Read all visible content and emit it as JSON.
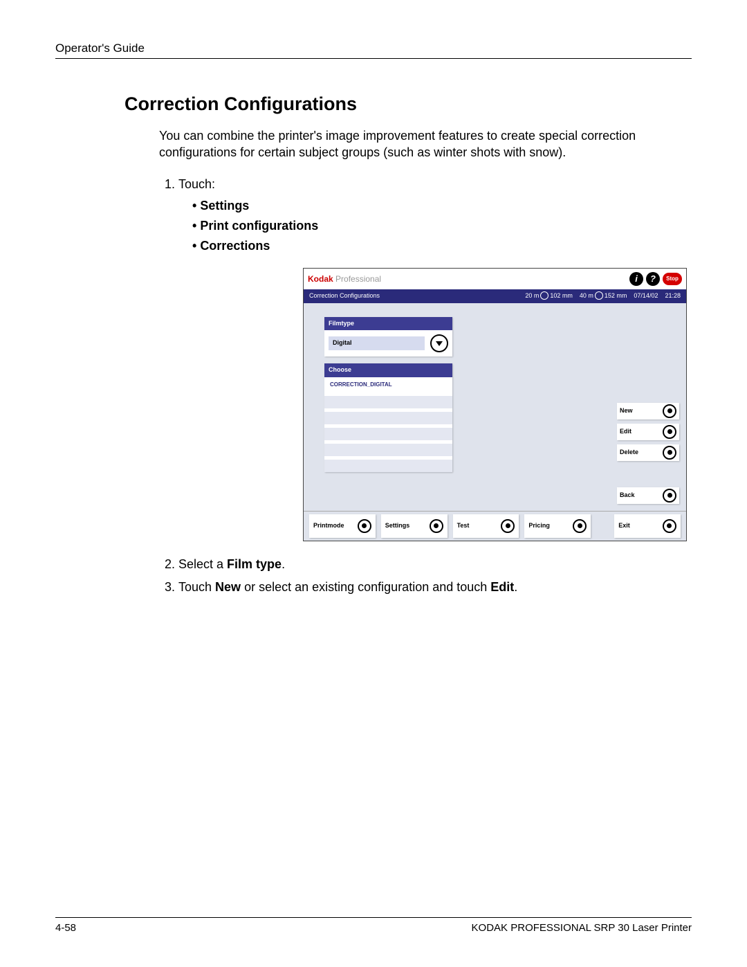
{
  "doc": {
    "header": "Operator's Guide",
    "title": "Correction Configurations",
    "intro": "You can combine the printer's image improvement features to create special correction configurations for certain subject groups (such as winter shots with snow).",
    "step1_lead": "Touch:",
    "bullets": [
      "Settings",
      "Print configurations",
      "Corrections"
    ],
    "step2_pre": "Select a ",
    "step2_bold": "Film type",
    "step2_post": ".",
    "step3_a": "Touch ",
    "step3_b": "New",
    "step3_c": " or select an existing configuration and touch ",
    "step3_d": "Edit",
    "step3_e": ".",
    "page_num": "4-58",
    "footer_right": "KODAK PROFESSIONAL SRP 30 Laser Printer"
  },
  "ui": {
    "brand_k": "Kodak",
    "brand_p": " Professional",
    "stop": "Stop",
    "bar_title": "Correction Configurations",
    "status_a": "20 m",
    "status_b": "102 mm",
    "status_c": "40 m",
    "status_d": "152 mm",
    "status_date": "07/14/02",
    "status_time": "21:28",
    "filmtype_hd": "Filmtype",
    "filmtype_val": "Digital",
    "choose_hd": "Choose",
    "choose_item": "CORRECTION_DIGITAL",
    "btn_new": "New",
    "btn_edit": "Edit",
    "btn_delete": "Delete",
    "btn_back": "Back",
    "bot": {
      "printmode": "Printmode",
      "settings": "Settings",
      "test": "Test",
      "pricing": "Pricing",
      "exit": "Exit"
    }
  }
}
